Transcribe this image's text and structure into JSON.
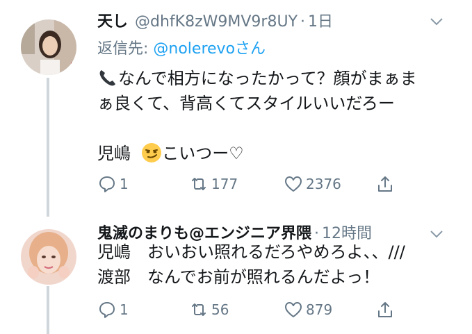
{
  "tweets": [
    {
      "display_name": "天し",
      "handle": "@dhfK8zW9MV9r8UY",
      "separator": "·",
      "time": "1日",
      "reply_to_prefix": "返信先: ",
      "reply_to_handle": "@nolerevo",
      "reply_to_suffix": "さん",
      "lines": [
        "なんで相方になったかって？顔がまぁま",
        "ぁ良くて、背高くてスタイルいいだろー"
      ],
      "last_line_name": "児嶋",
      "last_line_text": "こいつー♡",
      "replies": "1",
      "retweets": "177",
      "likes": "2376"
    },
    {
      "display_name": "鬼滅のまりも@エンジニア界隈",
      "separator": "·",
      "time": "12時間",
      "lines": [
        "児嶋　おいおい照れるだろやめろよ、、///",
        "渡部　なんでお前が照れるんだよっ！"
      ],
      "replies": "1",
      "retweets": "56",
      "likes": "879"
    }
  ],
  "icons": {
    "phone": "telephone-receiver-icon",
    "smirk": "smirking-face-emoji-icon",
    "reply": "reply-bubble-icon",
    "retweet": "retweet-icon",
    "like": "heart-icon",
    "share": "share-upload-icon",
    "caret": "chevron-down-icon"
  },
  "colors": {
    "muted": "#657786",
    "link": "#1da1f2",
    "thread_line": "#cfd6dc"
  }
}
